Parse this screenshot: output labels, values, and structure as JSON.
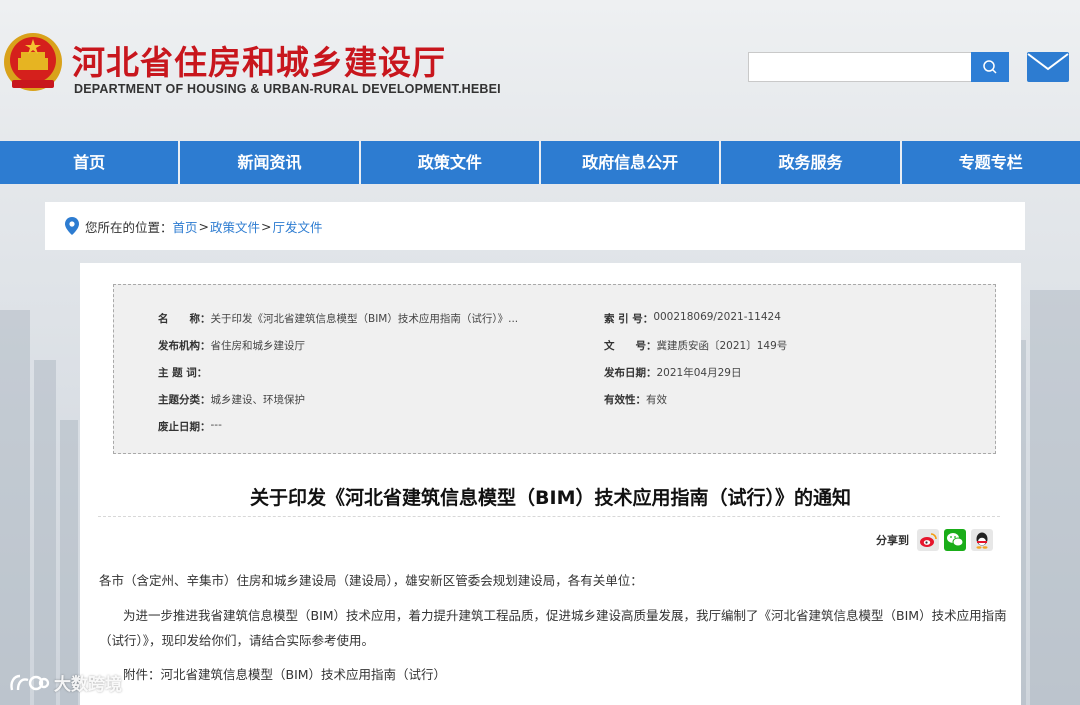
{
  "header": {
    "title": "河北省住房和城乡建设厅",
    "subtitle": "DEPARTMENT OF HOUSING & URBAN-RURAL DEVELOPMENT.HEBEI",
    "search_placeholder": "",
    "brand_red": "#c8161d",
    "brand_blue": "#2d7cd1"
  },
  "nav": {
    "items": [
      "首页",
      "新闻资讯",
      "政策文件",
      "政府信息公开",
      "政务服务",
      "专题专栏"
    ]
  },
  "breadcrumb": {
    "label": "您所在的位置：",
    "items": [
      "首页",
      "政策文件",
      "厅发文件"
    ],
    "sep": ">"
  },
  "meta": {
    "name_key": "名　　称：",
    "name_val": "关于印发《河北省建筑信息模型（BIM）技术应用指南（试行）》...",
    "index_key": "索 引 号：",
    "index_val": "000218069/2021-11424",
    "issuer_key": "发布机构：",
    "issuer_val": "省住房和城乡建设厅",
    "docno_key": "文　　号：",
    "docno_val": "冀建质安函〔2021〕149号",
    "subject_key": "主 题 词：",
    "subject_val": "",
    "date_key": "发布日期：",
    "date_val": "2021年04月29日",
    "category_key": "主题分类：",
    "category_val": "城乡建设、环境保护",
    "validity_key": "有效性：",
    "validity_val": "有效",
    "expiry_key": "废止日期：",
    "expiry_val": "---"
  },
  "article": {
    "title": "关于印发《河北省建筑信息模型（BIM）技术应用指南（试行）》的通知",
    "share_label": "分享到",
    "salutation": "各市（含定州、辛集市）住房和城乡建设局（建设局），雄安新区管委会规划建设局，各有关单位：",
    "body_line1": "为进一步推进我省建筑信息模型（BIM）技术应用，着力提升建筑工程品质，促进城乡建设高质量发展，我厅编制了《河北省建筑信息模型（BIM）技术应用指南",
    "body_line2": "（试行）》，现印发给你们，请结合实际参考使用。",
    "attachment": "附件：河北省建筑信息模型（BIM）技术应用指南（试行）"
  },
  "watermark": {
    "text": "大数跨境"
  }
}
